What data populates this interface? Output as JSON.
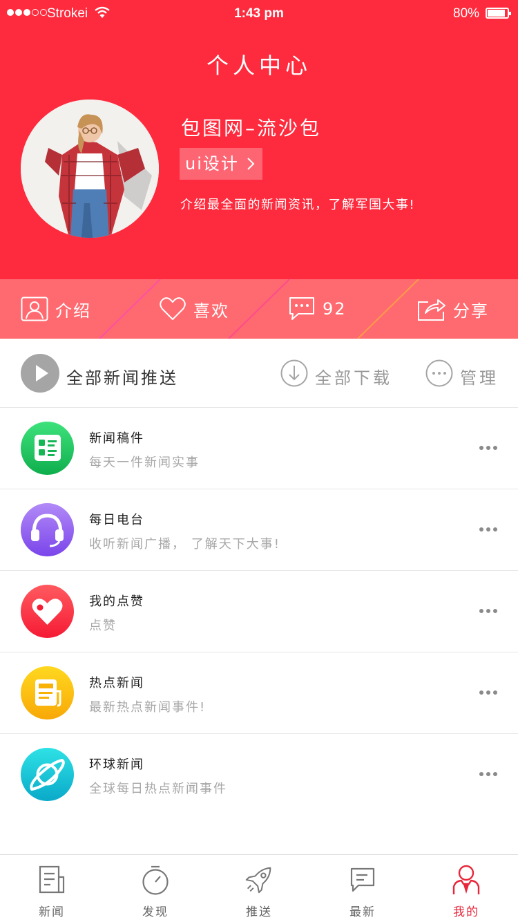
{
  "status_bar": {
    "carrier": "Strokei",
    "time": "1:43 pm",
    "battery": "80%"
  },
  "header": {
    "title": "个人中心",
    "username": "包图网–流沙包",
    "tag_label": "ui设计",
    "intro": "介绍最全面的新闻资讯，了解军国大事!"
  },
  "actions": [
    {
      "label": "介绍",
      "icon": "profile-icon"
    },
    {
      "label": "喜欢",
      "icon": "heart-icon"
    },
    {
      "label": "92",
      "icon": "comment-icon"
    },
    {
      "label": "分享",
      "icon": "share-icon"
    }
  ],
  "feed_bar": {
    "play_all": "全部新闻推送",
    "download_all": "全部下载",
    "manage": "管理"
  },
  "list": [
    {
      "title": "新闻稿件",
      "subtitle": "每天一件新闻实事",
      "icon": "news-draft-icon",
      "color": "#1cc15f"
    },
    {
      "title": "每日电台",
      "subtitle": "收听新闻广播， 了解天下大事!",
      "icon": "headphones-icon",
      "color": "#8d62ee"
    },
    {
      "title": "我的点赞",
      "subtitle": "点赞",
      "icon": "heart-like-icon",
      "color": "#fe2a3d"
    },
    {
      "title": "热点新闻",
      "subtitle": "最新热点新闻事件!",
      "icon": "hot-news-icon",
      "color": "#fcbf0d"
    },
    {
      "title": "环球新闻",
      "subtitle": "全球每日热点新闻事件",
      "icon": "planet-icon",
      "color": "#11c4d5"
    }
  ],
  "tabbar": [
    {
      "label": "新闻",
      "icon": "newspaper-icon",
      "active": false
    },
    {
      "label": "发现",
      "icon": "stopwatch-icon",
      "active": false
    },
    {
      "label": "推送",
      "icon": "rocket-icon",
      "active": false
    },
    {
      "label": "最新",
      "icon": "message-icon",
      "active": false
    },
    {
      "label": "我的",
      "icon": "user-icon",
      "active": true
    }
  ],
  "colors": {
    "brand": "#fe2a3d",
    "action_bar": "#ff6a70",
    "active_tab": "#e8263a"
  }
}
